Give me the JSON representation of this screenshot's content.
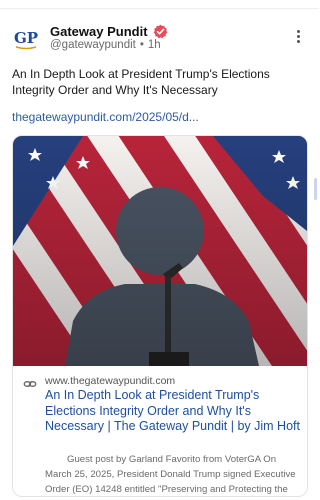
{
  "post": {
    "author_name": "Gateway Pundit",
    "handle": "@gatewaypundit",
    "separator": "•",
    "time": "1h",
    "avatar_text": "GP",
    "text": "An In Depth Look at President Trump's Elections Integrity Order and Why It's Necessary",
    "link_text": "thegatewaypundit.com/2025/05/d..."
  },
  "card": {
    "domain": "www.thegatewaypundit.com",
    "title": "An In Depth Look at President Trump's Elections Integrity Order and Why It's Necessary | The Gateway Pundit | by Jim Hoft",
    "description": "Guest post by Garland Favorito from VoterGA On March 25, 2025, President Donald Trump signed Executive Order (EO) 14248 entitled \"Preserving and Protecting the Integrity of American Elections\"."
  },
  "icons": {
    "verified": "verified-badge-icon",
    "more": "more-vertical-icon",
    "link": "link-icon"
  },
  "colors": {
    "link": "#2e5aa8",
    "card_title": "#1f4fa0",
    "verified": "#e74c5a",
    "avatar_blue": "#1d4aa0"
  }
}
